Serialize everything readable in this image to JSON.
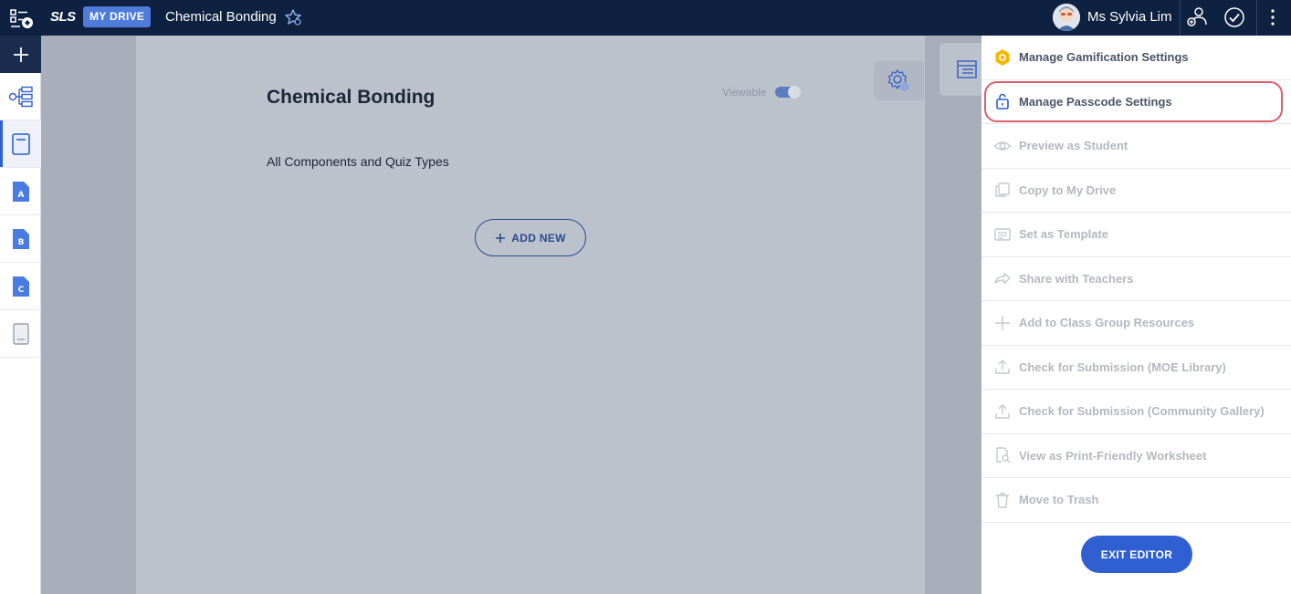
{
  "topbar": {
    "logo": "SLS",
    "drive_badge": "MY DRIVE",
    "title": "Chemical Bonding",
    "user_name": "Ms Sylvia Lim"
  },
  "page": {
    "title": "Chemical Bonding",
    "subtitle": "All Components and Quiz Types",
    "viewable_label": "Viewable",
    "viewable_on": true,
    "add_new_label": "ADD NEW"
  },
  "sidebar": {
    "items": [
      {
        "icon": "lesson-map-icon"
      },
      {
        "icon": "lesson-book-icon",
        "active": true
      },
      {
        "icon": "section-a-icon",
        "letter": "A"
      },
      {
        "icon": "section-b-icon",
        "letter": "B"
      },
      {
        "icon": "section-c-icon",
        "letter": "C"
      },
      {
        "icon": "notebook-icon"
      }
    ]
  },
  "menu": {
    "items": [
      {
        "label": "Manage Gamification Settings",
        "icon": "gamification-icon",
        "enabled": true
      },
      {
        "label": "Manage Passcode Settings",
        "icon": "lock-icon",
        "enabled": true,
        "highlighted": true
      },
      {
        "label": "Preview as Student",
        "icon": "eye-icon",
        "enabled": false
      },
      {
        "label": "Copy to My Drive",
        "icon": "copy-icon",
        "enabled": false
      },
      {
        "label": "Set as Template",
        "icon": "template-icon",
        "enabled": false
      },
      {
        "label": "Share with Teachers",
        "icon": "share-icon",
        "enabled": false
      },
      {
        "label": "Add to Class Group Resources",
        "icon": "plus-icon",
        "enabled": false
      },
      {
        "label": "Check for Submission (MOE Library)",
        "icon": "upload-icon",
        "enabled": false
      },
      {
        "label": "Check for Submission (Community Gallery)",
        "icon": "upload-icon",
        "enabled": false
      },
      {
        "label": "View as Print-Friendly Worksheet",
        "icon": "print-preview-icon",
        "enabled": false
      },
      {
        "label": "Move to Trash",
        "icon": "trash-icon",
        "enabled": false
      }
    ],
    "exit_label": "EXIT EDITOR"
  },
  "colors": {
    "topbar": "#0f2140",
    "accent": "#2f5fd1",
    "highlight": "#d9606d",
    "gamification": "#f2b705"
  }
}
